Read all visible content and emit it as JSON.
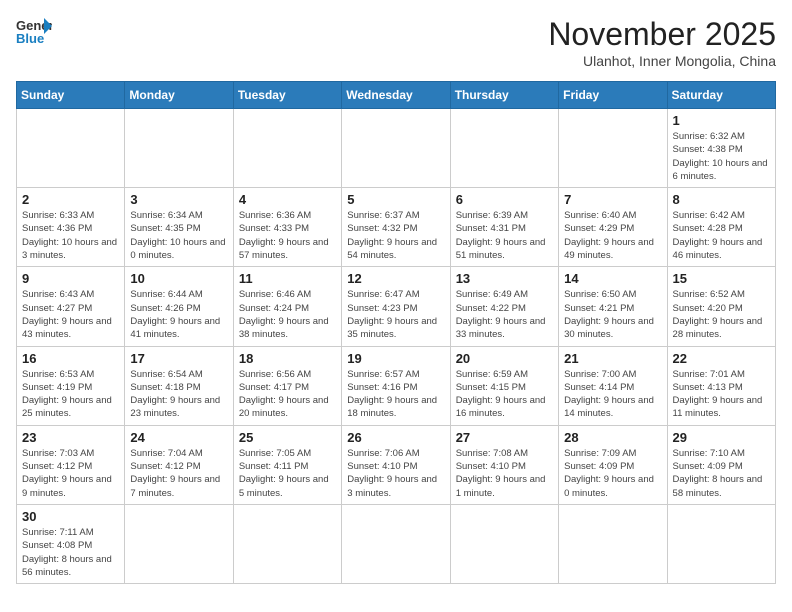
{
  "header": {
    "logo_text_general": "General",
    "logo_text_blue": "Blue",
    "month_title": "November 2025",
    "location": "Ulanhot, Inner Mongolia, China"
  },
  "weekdays": [
    "Sunday",
    "Monday",
    "Tuesday",
    "Wednesday",
    "Thursday",
    "Friday",
    "Saturday"
  ],
  "weeks": [
    [
      {
        "day": "",
        "info": ""
      },
      {
        "day": "",
        "info": ""
      },
      {
        "day": "",
        "info": ""
      },
      {
        "day": "",
        "info": ""
      },
      {
        "day": "",
        "info": ""
      },
      {
        "day": "",
        "info": ""
      },
      {
        "day": "1",
        "info": "Sunrise: 6:32 AM\nSunset: 4:38 PM\nDaylight: 10 hours and 6 minutes."
      }
    ],
    [
      {
        "day": "2",
        "info": "Sunrise: 6:33 AM\nSunset: 4:36 PM\nDaylight: 10 hours and 3 minutes."
      },
      {
        "day": "3",
        "info": "Sunrise: 6:34 AM\nSunset: 4:35 PM\nDaylight: 10 hours and 0 minutes."
      },
      {
        "day": "4",
        "info": "Sunrise: 6:36 AM\nSunset: 4:33 PM\nDaylight: 9 hours and 57 minutes."
      },
      {
        "day": "5",
        "info": "Sunrise: 6:37 AM\nSunset: 4:32 PM\nDaylight: 9 hours and 54 minutes."
      },
      {
        "day": "6",
        "info": "Sunrise: 6:39 AM\nSunset: 4:31 PM\nDaylight: 9 hours and 51 minutes."
      },
      {
        "day": "7",
        "info": "Sunrise: 6:40 AM\nSunset: 4:29 PM\nDaylight: 9 hours and 49 minutes."
      },
      {
        "day": "8",
        "info": "Sunrise: 6:42 AM\nSunset: 4:28 PM\nDaylight: 9 hours and 46 minutes."
      }
    ],
    [
      {
        "day": "9",
        "info": "Sunrise: 6:43 AM\nSunset: 4:27 PM\nDaylight: 9 hours and 43 minutes."
      },
      {
        "day": "10",
        "info": "Sunrise: 6:44 AM\nSunset: 4:26 PM\nDaylight: 9 hours and 41 minutes."
      },
      {
        "day": "11",
        "info": "Sunrise: 6:46 AM\nSunset: 4:24 PM\nDaylight: 9 hours and 38 minutes."
      },
      {
        "day": "12",
        "info": "Sunrise: 6:47 AM\nSunset: 4:23 PM\nDaylight: 9 hours and 35 minutes."
      },
      {
        "day": "13",
        "info": "Sunrise: 6:49 AM\nSunset: 4:22 PM\nDaylight: 9 hours and 33 minutes."
      },
      {
        "day": "14",
        "info": "Sunrise: 6:50 AM\nSunset: 4:21 PM\nDaylight: 9 hours and 30 minutes."
      },
      {
        "day": "15",
        "info": "Sunrise: 6:52 AM\nSunset: 4:20 PM\nDaylight: 9 hours and 28 minutes."
      }
    ],
    [
      {
        "day": "16",
        "info": "Sunrise: 6:53 AM\nSunset: 4:19 PM\nDaylight: 9 hours and 25 minutes."
      },
      {
        "day": "17",
        "info": "Sunrise: 6:54 AM\nSunset: 4:18 PM\nDaylight: 9 hours and 23 minutes."
      },
      {
        "day": "18",
        "info": "Sunrise: 6:56 AM\nSunset: 4:17 PM\nDaylight: 9 hours and 20 minutes."
      },
      {
        "day": "19",
        "info": "Sunrise: 6:57 AM\nSunset: 4:16 PM\nDaylight: 9 hours and 18 minutes."
      },
      {
        "day": "20",
        "info": "Sunrise: 6:59 AM\nSunset: 4:15 PM\nDaylight: 9 hours and 16 minutes."
      },
      {
        "day": "21",
        "info": "Sunrise: 7:00 AM\nSunset: 4:14 PM\nDaylight: 9 hours and 14 minutes."
      },
      {
        "day": "22",
        "info": "Sunrise: 7:01 AM\nSunset: 4:13 PM\nDaylight: 9 hours and 11 minutes."
      }
    ],
    [
      {
        "day": "23",
        "info": "Sunrise: 7:03 AM\nSunset: 4:12 PM\nDaylight: 9 hours and 9 minutes."
      },
      {
        "day": "24",
        "info": "Sunrise: 7:04 AM\nSunset: 4:12 PM\nDaylight: 9 hours and 7 minutes."
      },
      {
        "day": "25",
        "info": "Sunrise: 7:05 AM\nSunset: 4:11 PM\nDaylight: 9 hours and 5 minutes."
      },
      {
        "day": "26",
        "info": "Sunrise: 7:06 AM\nSunset: 4:10 PM\nDaylight: 9 hours and 3 minutes."
      },
      {
        "day": "27",
        "info": "Sunrise: 7:08 AM\nSunset: 4:10 PM\nDaylight: 9 hours and 1 minute."
      },
      {
        "day": "28",
        "info": "Sunrise: 7:09 AM\nSunset: 4:09 PM\nDaylight: 9 hours and 0 minutes."
      },
      {
        "day": "29",
        "info": "Sunrise: 7:10 AM\nSunset: 4:09 PM\nDaylight: 8 hours and 58 minutes."
      }
    ],
    [
      {
        "day": "30",
        "info": "Sunrise: 7:11 AM\nSunset: 4:08 PM\nDaylight: 8 hours and 56 minutes."
      },
      {
        "day": "",
        "info": ""
      },
      {
        "day": "",
        "info": ""
      },
      {
        "day": "",
        "info": ""
      },
      {
        "day": "",
        "info": ""
      },
      {
        "day": "",
        "info": ""
      },
      {
        "day": "",
        "info": ""
      }
    ]
  ]
}
